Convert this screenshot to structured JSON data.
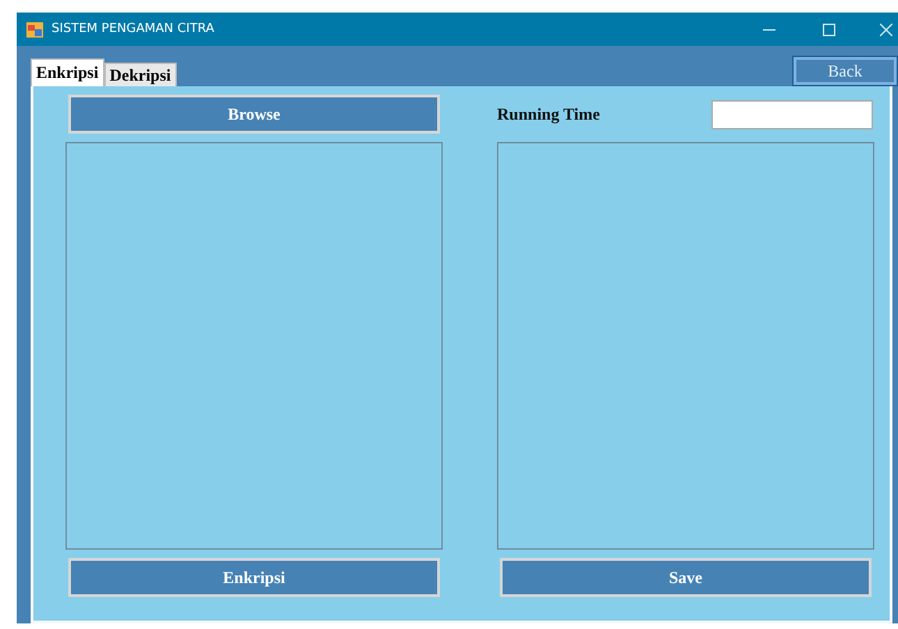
{
  "window": {
    "title": "SISTEM PENGAMAN CITRA"
  },
  "tabs": [
    {
      "label": "Enkripsi",
      "selected": true
    },
    {
      "label": "Dekripsi",
      "selected": false
    }
  ],
  "back_button": "Back",
  "browse_button": "Browse",
  "running_time": {
    "label": "Running Time"
  },
  "buttons": [
    "Enkripsi",
    "Save"
  ]
}
